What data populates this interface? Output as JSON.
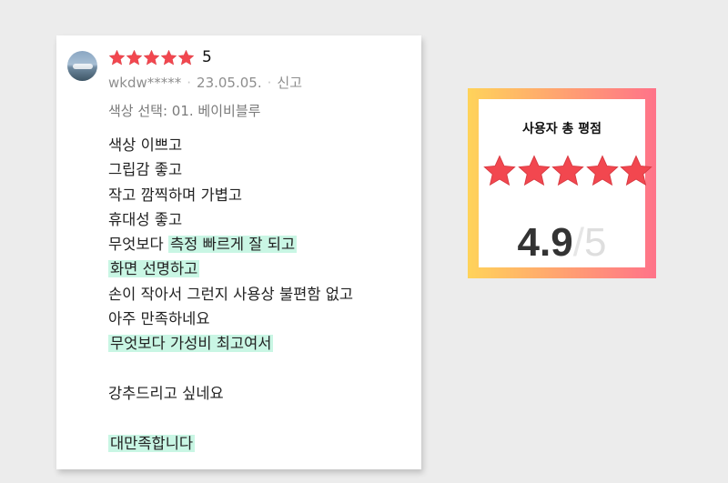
{
  "review": {
    "rating_stars": 5,
    "rating_value": "5",
    "username": "wkdw*****",
    "date": "23.05.05.",
    "report_label": "신고",
    "option": "색상 선택: 01. 베이비블루",
    "lines": [
      {
        "text": "색상 이쁘고"
      },
      {
        "text": "그립감 좋고"
      },
      {
        "text": "작고 깜찍하며 가볍고"
      },
      {
        "text": "휴대성 좋고"
      },
      {
        "prefix": "무엇보다 ",
        "highlight": "측정 빠르게 잘 되고"
      },
      {
        "highlight": "화면 선명하고"
      },
      {
        "text": "손이 작아서 그런지 사용상 불편함 없고"
      },
      {
        "text": "아주 만족하네요"
      },
      {
        "highlight": "무엇보다 가성비 최고여서"
      },
      {
        "text": ""
      },
      {
        "text": "강추드리고 싶네요"
      },
      {
        "text": ""
      },
      {
        "highlight": "대만족합니다"
      }
    ]
  },
  "score_panel": {
    "title": "사용자 총 평점",
    "stars": 5,
    "value": "4.9",
    "slash": "/",
    "max": "5"
  },
  "colors": {
    "star": "#f2474f",
    "highlight": "#c9f6e4",
    "gradient_start": "#ffd35a",
    "gradient_end": "#ff7389"
  },
  "icons": {
    "star": "star-icon",
    "avatar": "user-avatar"
  }
}
